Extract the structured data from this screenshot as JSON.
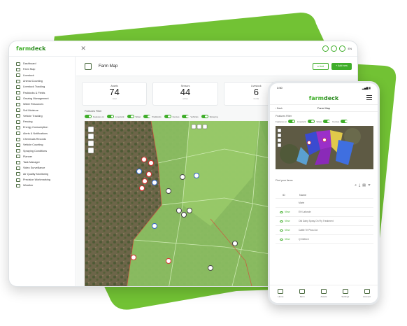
{
  "brand": {
    "logo": "farm",
    "logo_accent": "deck",
    "accent_color": "#3fae2a",
    "blob_color": "#72c234"
  },
  "tablet": {
    "close_label": "✕",
    "user_label": "EN",
    "sidebar": {
      "items": [
        {
          "label": "Dashboard"
        },
        {
          "label": "Farm Map"
        },
        {
          "label": "Livestock"
        },
        {
          "label": "Animal Counting"
        },
        {
          "label": "Livestock Tracking"
        },
        {
          "label": "Paddocks & Fields"
        },
        {
          "label": "Grazing Management"
        },
        {
          "label": "Water Resources"
        },
        {
          "label": "Soil Moisture"
        },
        {
          "label": "Vehicle Tracking"
        },
        {
          "label": "Fencing"
        },
        {
          "label": "Energy Consumption"
        },
        {
          "label": "Alerts & Notifications"
        },
        {
          "label": "Chemicals Records"
        },
        {
          "label": "Vehicle Counting"
        },
        {
          "label": "Spraying Conditions"
        },
        {
          "label": "Planner"
        },
        {
          "label": "Task Manager"
        },
        {
          "label": "Video Surveillance"
        },
        {
          "label": "Air Quality Monitoring"
        },
        {
          "label": "Precision Workmarking"
        },
        {
          "label": "Weather"
        }
      ]
    },
    "header": {
      "title": "Farm Map",
      "btn_secondary": "● Add",
      "btn_primary": "+ Add new"
    },
    "stats": [
      {
        "label": "Assets",
        "value": "74",
        "sub": "total"
      },
      {
        "label": "Sensors",
        "value": "44",
        "sub": "active"
      },
      {
        "label": "Livestock",
        "value": "6",
        "sub": "herds"
      }
    ],
    "features_label": "Features Filter",
    "toggles": [
      {
        "label": "Features on"
      },
      {
        "label": "Livestock"
      },
      {
        "label": "Water"
      },
      {
        "label": "Paddocks"
      },
      {
        "label": "Fences"
      },
      {
        "label": "Vehicles"
      },
      {
        "label": "Spraying"
      }
    ]
  },
  "phone": {
    "time": "3:50",
    "signal": "▂▄▆ ▮",
    "logo": "farm",
    "logo_accent": "deck",
    "back_label": "‹ Back",
    "nav_title": "Farm Map",
    "features_label": "Features Filter",
    "toggles": [
      {
        "label": "Features on"
      },
      {
        "label": "Livestock"
      },
      {
        "label": "Water"
      },
      {
        "label": "Fences"
      }
    ],
    "table_label": "Find your items",
    "tools": [
      "⌕",
      "⤓",
      "▤",
      "⏷"
    ],
    "table": {
      "col_id": "ID",
      "col_name": "Name",
      "rows": [
        {
          "view": "",
          "name": "Marie"
        },
        {
          "view": "View",
          "name": "EH Lafonde"
        },
        {
          "view": "View",
          "name": "Old Dairy Spray On Fly Treatment"
        },
        {
          "view": "View",
          "name": "Cattle Tri Phus Ltd"
        },
        {
          "view": "View",
          "name": "Q Dietrich"
        }
      ]
    },
    "tabs": [
      {
        "label": "Home"
      },
      {
        "label": "Farm"
      },
      {
        "label": "Assets"
      },
      {
        "label": "Settings"
      },
      {
        "label": "Account"
      }
    ]
  }
}
